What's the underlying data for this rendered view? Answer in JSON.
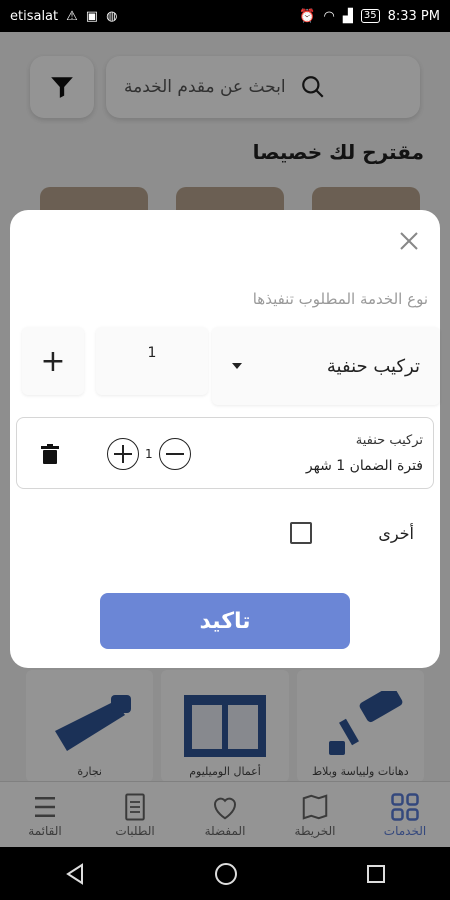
{
  "status_bar": {
    "carrier": "etisalat",
    "battery": "35",
    "time": "8:33 PM"
  },
  "search": {
    "placeholder": "ابحث عن مقدم الخدمة"
  },
  "suggested_title": "مقترح لك خصيصا",
  "categories": [
    {
      "label": "دهانات وليياسة وبلاط",
      "icon": "paint-roller-icon"
    },
    {
      "label": "أعمال الوميليوم",
      "icon": "window-frame-icon"
    },
    {
      "label": "نجارة",
      "icon": "saw-icon"
    }
  ],
  "bottom_nav": [
    {
      "label": "الخدمات",
      "icon": "grid-icon",
      "active": true
    },
    {
      "label": "الخريطة",
      "icon": "map-pin-icon",
      "active": false
    },
    {
      "label": "المفضلة",
      "icon": "heart-icon",
      "active": false
    },
    {
      "label": "الطلبات",
      "icon": "document-icon",
      "active": false
    },
    {
      "label": "القائمة",
      "icon": "menu-icon",
      "active": false
    }
  ],
  "dialog": {
    "service_type_label": "نوع الخدمة المطلوب تنفيذها",
    "selected_service": "تركيب حنفية",
    "quantity": "1",
    "add_symbol": "+",
    "item": {
      "name": "تركيب حنفية",
      "warranty": "فترة الضمان 1 شهر",
      "count": "1"
    },
    "other_label": "أخرى",
    "confirm_label": "تاكيد"
  },
  "colors": {
    "accent": "#6b86d6",
    "overlay": "rgba(0,0,0,0.42)"
  }
}
